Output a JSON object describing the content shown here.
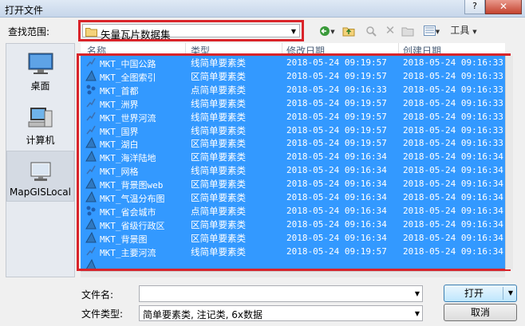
{
  "window": {
    "title": "打开文件",
    "help_label": "?",
    "close_label": "✕"
  },
  "toolbar": {
    "lookin_label": "查找范围:",
    "lookin_value": "矢量瓦片数据集",
    "tools_label": "工具",
    "icons": [
      "back-icon",
      "up-folder-icon",
      "search-web-icon",
      "delete-icon",
      "new-folder-icon",
      "view-menu-icon",
      "tools-menu"
    ]
  },
  "places": [
    {
      "label": "桌面",
      "icon": "desktop-icon"
    },
    {
      "label": "计算机",
      "icon": "computer-icon"
    },
    {
      "label": "MapGISLocal",
      "icon": "mapgis-local-icon",
      "selected": true
    }
  ],
  "columns": [
    "名称",
    "类型",
    "修改日期",
    "创建日期"
  ],
  "files": [
    {
      "name": "MKT_中国公路",
      "type": "线简单要素类",
      "modified": "2018-05-24 09:19:57",
      "created": "2018-05-24 09:16:33",
      "icon": "line"
    },
    {
      "name": "MKT_全图索引",
      "type": "区简单要素类",
      "modified": "2018-05-24 09:19:57",
      "created": "2018-05-24 09:16:33",
      "icon": "polygon"
    },
    {
      "name": "MKT_首都",
      "type": "点简单要素类",
      "modified": "2018-05-24 09:16:33",
      "created": "2018-05-24 09:16:33",
      "icon": "point"
    },
    {
      "name": "MKT_洲界",
      "type": "线简单要素类",
      "modified": "2018-05-24 09:19:57",
      "created": "2018-05-24 09:16:33",
      "icon": "line"
    },
    {
      "name": "MKT_世界河流",
      "type": "线简单要素类",
      "modified": "2018-05-24 09:19:57",
      "created": "2018-05-24 09:16:33",
      "icon": "line"
    },
    {
      "name": "MKT_国界",
      "type": "线简单要素类",
      "modified": "2018-05-24 09:19:57",
      "created": "2018-05-24 09:16:33",
      "icon": "line"
    },
    {
      "name": "MKT_湖白",
      "type": "区简单要素类",
      "modified": "2018-05-24 09:19:57",
      "created": "2018-05-24 09:16:33",
      "icon": "polygon"
    },
    {
      "name": "MKT_海洋陆地",
      "type": "区简单要素类",
      "modified": "2018-05-24 09:16:34",
      "created": "2018-05-24 09:16:34",
      "icon": "polygon"
    },
    {
      "name": "MKT_网格",
      "type": "线简单要素类",
      "modified": "2018-05-24 09:16:34",
      "created": "2018-05-24 09:16:34",
      "icon": "line"
    },
    {
      "name": "MKT_背景图web",
      "type": "区简单要素类",
      "modified": "2018-05-24 09:16:34",
      "created": "2018-05-24 09:16:34",
      "icon": "polygon"
    },
    {
      "name": "MKT_气温分布图",
      "type": "区简单要素类",
      "modified": "2018-05-24 09:16:34",
      "created": "2018-05-24 09:16:34",
      "icon": "polygon"
    },
    {
      "name": "MKT_省会城市",
      "type": "点简单要素类",
      "modified": "2018-05-24 09:16:34",
      "created": "2018-05-24 09:16:34",
      "icon": "point"
    },
    {
      "name": "MKT_省级行政区",
      "type": "区简单要素类",
      "modified": "2018-05-24 09:16:34",
      "created": "2018-05-24 09:16:34",
      "icon": "polygon"
    },
    {
      "name": "MKT_背景图",
      "type": "区简单要素类",
      "modified": "2018-05-24 09:16:34",
      "created": "2018-05-24 09:16:34",
      "icon": "polygon"
    },
    {
      "name": "MKT_主要河流",
      "type": "线简单要素类",
      "modified": "2018-05-24 09:19:57",
      "created": "2018-05-24 09:16:34",
      "icon": "line"
    },
    {
      "name": "",
      "type": "",
      "modified": "",
      "created": "",
      "icon": "polygon"
    }
  ],
  "footer": {
    "filename_label": "文件名:",
    "filename_value": "",
    "filetype_label": "文件类型:",
    "filetype_value": "简单要素类, 注记类, 6x数据",
    "open_label": "打开",
    "cancel_label": "取消"
  },
  "colors": {
    "selection": "#3399ff",
    "highlight_border": "#d9242a"
  }
}
